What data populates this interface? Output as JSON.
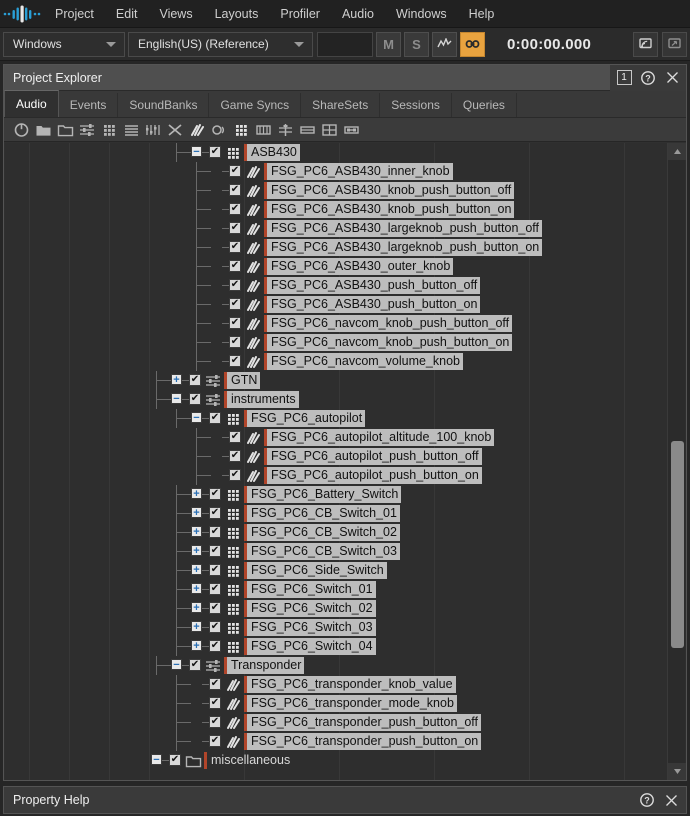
{
  "menu": {
    "logo_icon": "wwise-logo-icon",
    "items": [
      "Project",
      "Edit",
      "Views",
      "Layouts",
      "Profiler",
      "Audio",
      "Windows",
      "Help"
    ]
  },
  "transport": {
    "platform_value": "Windows",
    "language_value": "English(US) (Reference)",
    "mute_label": "M",
    "solo_label": "S",
    "graph_icon": "waveform-icon",
    "link_icon": "link-icon",
    "link_active_color": "#e9a33f",
    "timecode": "0:00:00.000",
    "right_icons": [
      "remote-connect-icon",
      "reconnect-icon"
    ]
  },
  "project_explorer": {
    "title": "Project Explorer",
    "view_number": "1",
    "help_icon": "help-icon",
    "close_icon": "close-icon",
    "tabs": [
      {
        "label": "Audio",
        "active": true
      },
      {
        "label": "Events",
        "active": false
      },
      {
        "label": "SoundBanks",
        "active": false
      },
      {
        "label": "Game Syncs",
        "active": false
      },
      {
        "label": "ShareSets",
        "active": false
      },
      {
        "label": "Sessions",
        "active": false
      },
      {
        "label": "Queries",
        "active": false
      }
    ],
    "toolbar_icons": [
      "power-icon",
      "folder-filled-icon",
      "folder-open-icon",
      "mixer-icon",
      "grid-icon",
      "list-icon",
      "blend-icon",
      "random-icon",
      "sound-sfx-icon",
      "motion-icon",
      "actor-mixer-icon",
      "interactive-music-icon",
      "music-switch-icon",
      "music-playlist-icon",
      "music-segment-icon",
      "music-track-icon"
    ]
  },
  "scrollbar": {
    "up_arrow_icon": "triangle-up-icon",
    "down_arrow_icon": "triangle-down-icon"
  },
  "tree": {
    "rows": [
      {
        "label": "ASB430",
        "depth": 3,
        "expander": "minus",
        "checked": true,
        "icon": "actor-mixer-icon",
        "selected": true
      },
      {
        "label": "FSG_PC6_ASB430_inner_knob",
        "depth": 4,
        "expander": "",
        "checked": true,
        "icon": "sound-sfx-icon",
        "selected": true
      },
      {
        "label": "FSG_PC6_ASB430_knob_push_button_off",
        "depth": 4,
        "expander": "",
        "checked": true,
        "icon": "sound-sfx-icon",
        "selected": true
      },
      {
        "label": "FSG_PC6_ASB430_knob_push_button_on",
        "depth": 4,
        "expander": "",
        "checked": true,
        "icon": "sound-sfx-icon",
        "selected": true
      },
      {
        "label": "FSG_PC6_ASB430_largeknob_push_button_off",
        "depth": 4,
        "expander": "",
        "checked": true,
        "icon": "sound-sfx-icon",
        "selected": true
      },
      {
        "label": "FSG_PC6_ASB430_largeknob_push_button_on",
        "depth": 4,
        "expander": "",
        "checked": true,
        "icon": "sound-sfx-icon",
        "selected": true
      },
      {
        "label": "FSG_PC6_ASB430_outer_knob",
        "depth": 4,
        "expander": "",
        "checked": true,
        "icon": "sound-sfx-icon",
        "selected": true
      },
      {
        "label": "FSG_PC6_ASB430_push_button_off",
        "depth": 4,
        "expander": "",
        "checked": true,
        "icon": "sound-sfx-icon",
        "selected": true
      },
      {
        "label": "FSG_PC6_ASB430_push_button_on",
        "depth": 4,
        "expander": "",
        "checked": true,
        "icon": "sound-sfx-icon",
        "selected": true
      },
      {
        "label": "FSG_PC6_navcom_knob_push_button_off",
        "depth": 4,
        "expander": "",
        "checked": true,
        "icon": "sound-sfx-icon",
        "selected": true
      },
      {
        "label": "FSG_PC6_navcom_knob_push_button_on",
        "depth": 4,
        "expander": "",
        "checked": true,
        "icon": "sound-sfx-icon",
        "selected": true
      },
      {
        "label": "FSG_PC6_navcom_volume_knob",
        "depth": 4,
        "expander": "",
        "checked": true,
        "icon": "sound-sfx-icon",
        "selected": true
      },
      {
        "label": "GTN",
        "depth": 2,
        "expander": "plus",
        "checked": true,
        "icon": "mixer-icon",
        "selected": true
      },
      {
        "label": "instruments",
        "depth": 2,
        "expander": "minus",
        "checked": true,
        "icon": "mixer-icon",
        "selected": true
      },
      {
        "label": "FSG_PC6_autopilot",
        "depth": 3,
        "expander": "minus",
        "checked": true,
        "icon": "actor-mixer-icon",
        "selected": true
      },
      {
        "label": "FSG_PC6_autopilot_altitude_100_knob",
        "depth": 4,
        "expander": "",
        "checked": true,
        "icon": "sound-sfx-icon",
        "selected": true
      },
      {
        "label": "FSG_PC6_autopilot_push_button_off",
        "depth": 4,
        "expander": "",
        "checked": true,
        "icon": "sound-sfx-icon",
        "selected": true
      },
      {
        "label": "FSG_PC6_autopilot_push_button_on",
        "depth": 4,
        "expander": "",
        "checked": true,
        "icon": "sound-sfx-icon",
        "selected": true
      },
      {
        "label": "FSG_PC6_Battery_Switch",
        "depth": 3,
        "expander": "plus",
        "checked": true,
        "icon": "actor-mixer-icon",
        "selected": true
      },
      {
        "label": "FSG_PC6_CB_Switch_01",
        "depth": 3,
        "expander": "plus",
        "checked": true,
        "icon": "actor-mixer-icon",
        "selected": true
      },
      {
        "label": "FSG_PC6_CB_Switch_02",
        "depth": 3,
        "expander": "plus",
        "checked": true,
        "icon": "actor-mixer-icon",
        "selected": true
      },
      {
        "label": "FSG_PC6_CB_Switch_03",
        "depth": 3,
        "expander": "plus",
        "checked": true,
        "icon": "actor-mixer-icon",
        "selected": true
      },
      {
        "label": "FSG_PC6_Side_Switch",
        "depth": 3,
        "expander": "plus",
        "checked": true,
        "icon": "actor-mixer-icon",
        "selected": true
      },
      {
        "label": "FSG_PC6_Switch_01",
        "depth": 3,
        "expander": "plus",
        "checked": true,
        "icon": "actor-mixer-icon",
        "selected": true
      },
      {
        "label": "FSG_PC6_Switch_02",
        "depth": 3,
        "expander": "plus",
        "checked": true,
        "icon": "actor-mixer-icon",
        "selected": true
      },
      {
        "label": "FSG_PC6_Switch_03",
        "depth": 3,
        "expander": "plus",
        "checked": true,
        "icon": "actor-mixer-icon",
        "selected": true
      },
      {
        "label": "FSG_PC6_Switch_04",
        "depth": 3,
        "expander": "plus",
        "checked": true,
        "icon": "actor-mixer-icon",
        "selected": true
      },
      {
        "label": "Transponder",
        "depth": 2,
        "expander": "minus",
        "checked": true,
        "icon": "mixer-icon",
        "selected": true
      },
      {
        "label": "FSG_PC6_transponder_knob_value",
        "depth": 3,
        "expander": "",
        "checked": true,
        "icon": "sound-sfx-icon",
        "selected": true
      },
      {
        "label": "FSG_PC6_transponder_mode_knob",
        "depth": 3,
        "expander": "",
        "checked": true,
        "icon": "sound-sfx-icon",
        "selected": true
      },
      {
        "label": "FSG_PC6_transponder_push_button_off",
        "depth": 3,
        "expander": "",
        "checked": true,
        "icon": "sound-sfx-icon",
        "selected": true
      },
      {
        "label": "FSG_PC6_transponder_push_button_on",
        "depth": 3,
        "expander": "",
        "checked": true,
        "icon": "sound-sfx-icon",
        "selected": true
      },
      {
        "label": "miscellaneous",
        "depth": 1,
        "expander": "minus",
        "checked": true,
        "icon": "folder-open-icon",
        "selected": false
      }
    ]
  },
  "property_help": {
    "title": "Property Help",
    "help_icon": "help-icon",
    "close_icon": "close-icon"
  }
}
